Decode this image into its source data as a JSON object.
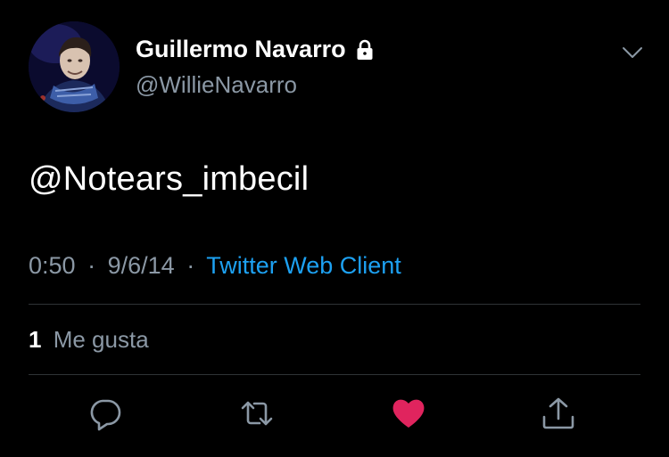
{
  "user": {
    "display_name": "Guillermo Navarro",
    "handle": "@WillieNavarro",
    "protected_icon": "lock-icon"
  },
  "tweet": {
    "text": "@Notears_imbecil",
    "time": "0:50",
    "date": "9/6/14",
    "separator": "·",
    "client": "Twitter Web Client"
  },
  "stats": {
    "likes_count": "1",
    "likes_label": "Me gusta"
  },
  "actions": [
    {
      "name": "reply",
      "icon": "comment-icon"
    },
    {
      "name": "retweet",
      "icon": "retweet-icon"
    },
    {
      "name": "like",
      "icon": "heart-icon",
      "active": true
    },
    {
      "name": "share",
      "icon": "share-icon"
    }
  ],
  "colors": {
    "background": "#000000",
    "secondary_text": "#8b98a5",
    "link": "#1da1f2",
    "like_active": "#e0245e",
    "divider": "#2f3336"
  }
}
